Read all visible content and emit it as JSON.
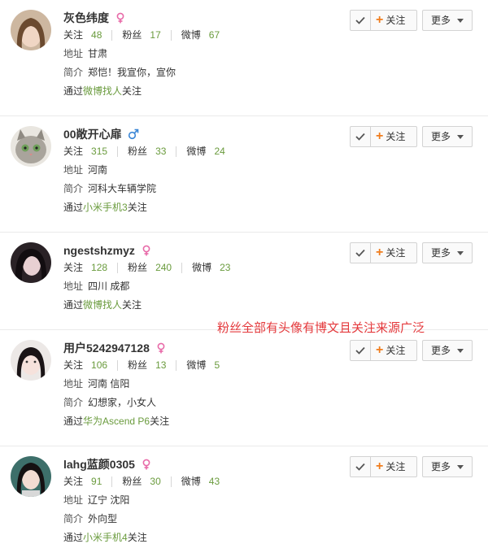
{
  "labels": {
    "follow_stat": "关注",
    "fans_stat": "粉丝",
    "weibo_stat": "微博",
    "address": "地址",
    "bio": "简介",
    "via_prefix": "通过",
    "via_suffix": "关注",
    "follow_button": "关注",
    "more_button": "更多"
  },
  "users": [
    {
      "name": "灰色纬度",
      "gender": "female",
      "following": "48",
      "fans": "17",
      "weibo": "67",
      "address": "甘肃",
      "bio": "郑恺！我宣你，宣你",
      "source": "微博找人"
    },
    {
      "name": "00敞开心扉",
      "gender": "male",
      "following": "315",
      "fans": "33",
      "weibo": "24",
      "address": "河南",
      "bio": "河科大车辆学院",
      "source": "小米手机3"
    },
    {
      "name": "ngestshzmyz",
      "gender": "female",
      "following": "128",
      "fans": "240",
      "weibo": "23",
      "address": "四川 成都",
      "bio": "",
      "source": "微博找人"
    },
    {
      "name": "用户5242947128",
      "gender": "female",
      "following": "106",
      "fans": "13",
      "weibo": "5",
      "address": "河南 信阳",
      "bio": "幻想家，小女人",
      "source": "华为Ascend P6"
    },
    {
      "name": "lahg蓝颜0305",
      "gender": "female",
      "following": "91",
      "fans": "30",
      "weibo": "43",
      "address": "辽宁 沈阳",
      "bio": "外向型",
      "source": "小米手机4"
    }
  ],
  "annotation": "粉丝全部有头像有博文且关注来源广泛",
  "colors": {
    "stat_number": "#6a9b3d",
    "link": "#6a9b3d",
    "follow_plus": "#f07d1e",
    "female": "#e86aa8",
    "male": "#3a86d6",
    "annotation": "#e4393c"
  }
}
